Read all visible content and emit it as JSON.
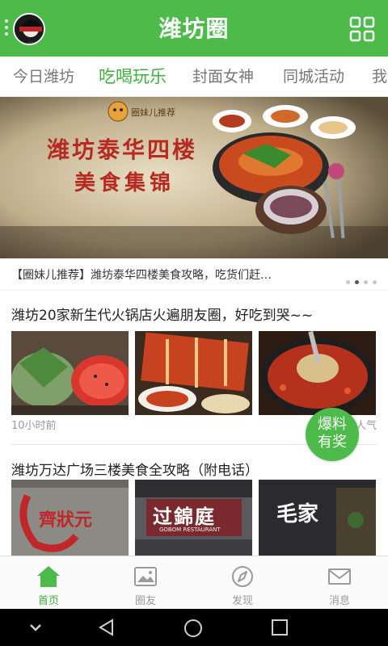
{
  "app": {
    "title": "潍坊圈"
  },
  "header": {
    "avatar_icon": "avatar-icon",
    "menu_icon": "vertical-dots-icon",
    "grid_icon": "grid-icon"
  },
  "tabs": [
    {
      "label": "今日潍坊",
      "active": false
    },
    {
      "label": "吃喝玩乐",
      "active": true
    },
    {
      "label": "封面女神",
      "active": false
    },
    {
      "label": "同城活动",
      "active": false
    },
    {
      "label": "我",
      "active": false
    }
  ],
  "banner": {
    "headline_line1": "潍坊泰华四楼",
    "headline_line2": "美食集锦",
    "logo_text": "圈妹儿推荐",
    "caption": "【圈妹儿推荐】潍坊泰华四楼美食攻略，吃货们赶…",
    "page_count": 4,
    "active_page": 2
  },
  "articles": [
    {
      "title": "潍坊20家新生代火锅店火遍朋友圈，好吃到哭~~",
      "time": "10小时前",
      "popularity": "人气"
    },
    {
      "title": "潍坊万达广场三楼美食全攻略（附电话）",
      "sign1": "齊狀元",
      "sign2": "过錦庭",
      "sign2_sub": "GOBOM RESTAURANT",
      "sign3": "毛家"
    }
  ],
  "fab": {
    "line1": "爆料",
    "line2": "有奖"
  },
  "bottom_nav": [
    {
      "label": "首页",
      "icon": "home-icon",
      "active": true
    },
    {
      "label": "圈友",
      "icon": "image-icon",
      "active": false
    },
    {
      "label": "发现",
      "icon": "compass-icon",
      "active": false
    },
    {
      "label": "消息",
      "icon": "mail-icon",
      "active": false
    }
  ],
  "system_nav": {
    "icons": [
      "chevron-down-icon",
      "back-icon",
      "home-circle-icon",
      "recents-icon"
    ]
  },
  "colors": {
    "brand_green": "#4cbb4a",
    "active_tab": "#3eb13c",
    "muted_text": "#999999"
  }
}
